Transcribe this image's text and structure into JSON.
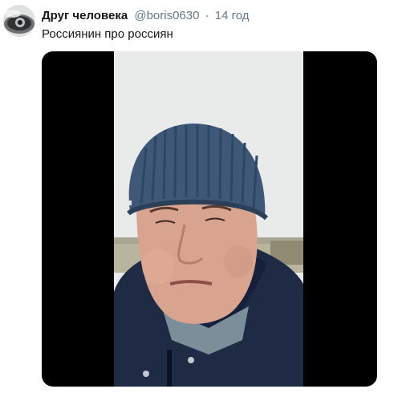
{
  "tweet": {
    "author_name": "Друг человека",
    "author_handle": "@boris0630",
    "separator": "·",
    "timestamp": "14 год",
    "text": "Россиянин про россиян",
    "avatar_icon": "user-avatar",
    "media_type": "video"
  },
  "colors": {
    "name": "#14171a",
    "meta": "#657786",
    "media_background": "#000000"
  }
}
